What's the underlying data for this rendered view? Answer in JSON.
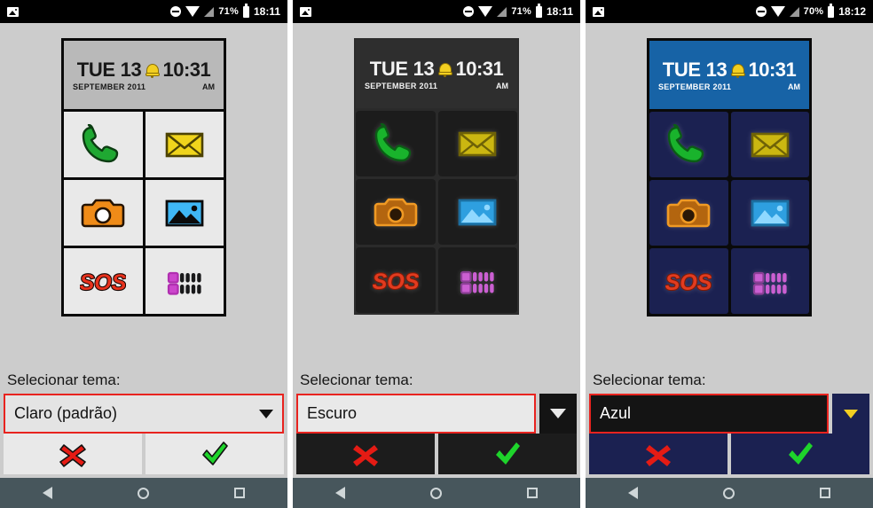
{
  "screens": [
    {
      "theme_key": "light",
      "statusbar": {
        "photo_icon": "photo-icon",
        "dnd_icon": "do-not-disturb-icon",
        "wifi_icon": "wifi-icon",
        "signal_icon": "signal-icon",
        "battery_percent": "71%",
        "battery_icon": "battery-icon",
        "time": "18:11"
      },
      "clock": {
        "date": "TUE 13",
        "time": "10:31",
        "month": "SEPTEMBER 2011",
        "ampm": "AM",
        "bell_icon": "alarm-bell-icon"
      },
      "tiles": [
        {
          "name": "phone",
          "icon": "phone-icon"
        },
        {
          "name": "messages",
          "icon": "envelope-icon"
        },
        {
          "name": "camera",
          "icon": "camera-icon"
        },
        {
          "name": "gallery",
          "icon": "picture-icon"
        },
        {
          "name": "sos",
          "icon": "sos-icon"
        },
        {
          "name": "apps",
          "icon": "apps-grid-icon"
        }
      ],
      "selector": {
        "label": "Selecionar tema:",
        "value": "Claro (padrão)",
        "caret_icon": "chevron-down-icon",
        "separate_arrow_button": false
      },
      "actions": {
        "cancel_icon": "red-x-icon",
        "confirm_icon": "green-check-icon"
      },
      "navbar": {
        "back_icon": "back-triangle-icon",
        "home_icon": "home-circle-icon",
        "recents_icon": "recents-square-icon"
      }
    },
    {
      "theme_key": "dark",
      "statusbar": {
        "photo_icon": "photo-icon",
        "dnd_icon": "do-not-disturb-icon",
        "wifi_icon": "wifi-icon",
        "signal_icon": "signal-icon",
        "battery_percent": "71%",
        "battery_icon": "battery-icon",
        "time": "18:11"
      },
      "clock": {
        "date": "TUE 13",
        "time": "10:31",
        "month": "SEPTEMBER 2011",
        "ampm": "AM",
        "bell_icon": "alarm-bell-icon"
      },
      "tiles": [
        {
          "name": "phone",
          "icon": "phone-icon"
        },
        {
          "name": "messages",
          "icon": "envelope-icon"
        },
        {
          "name": "camera",
          "icon": "camera-icon"
        },
        {
          "name": "gallery",
          "icon": "picture-icon"
        },
        {
          "name": "sos",
          "icon": "sos-icon"
        },
        {
          "name": "apps",
          "icon": "apps-grid-icon"
        }
      ],
      "selector": {
        "label": "Selecionar tema:",
        "value": "Escuro",
        "caret_icon": "chevron-down-icon",
        "separate_arrow_button": true
      },
      "actions": {
        "cancel_icon": "red-x-icon",
        "confirm_icon": "green-check-icon"
      },
      "navbar": {
        "back_icon": "back-triangle-icon",
        "home_icon": "home-circle-icon",
        "recents_icon": "recents-square-icon"
      }
    },
    {
      "theme_key": "blue",
      "statusbar": {
        "photo_icon": "photo-icon",
        "dnd_icon": "do-not-disturb-icon",
        "wifi_icon": "wifi-icon",
        "signal_icon": "signal-icon",
        "battery_percent": "70%",
        "battery_icon": "battery-icon",
        "time": "18:12"
      },
      "clock": {
        "date": "TUE 13",
        "time": "10:31",
        "month": "SEPTEMBER 2011",
        "ampm": "AM",
        "bell_icon": "alarm-bell-icon"
      },
      "tiles": [
        {
          "name": "phone",
          "icon": "phone-icon"
        },
        {
          "name": "messages",
          "icon": "envelope-icon"
        },
        {
          "name": "camera",
          "icon": "camera-icon"
        },
        {
          "name": "gallery",
          "icon": "picture-icon"
        },
        {
          "name": "sos",
          "icon": "sos-icon"
        },
        {
          "name": "apps",
          "icon": "apps-grid-icon"
        }
      ],
      "selector": {
        "label": "Selecionar tema:",
        "value": "Azul",
        "caret_icon": "chevron-down-icon",
        "separate_arrow_button": true
      },
      "actions": {
        "cancel_icon": "red-x-icon",
        "confirm_icon": "green-check-icon"
      },
      "navbar": {
        "back_icon": "back-triangle-icon",
        "home_icon": "home-circle-icon",
        "recents_icon": "recents-square-icon"
      }
    }
  ],
  "theme_options": [
    "Claro (padrão)",
    "Escuro",
    "Azul"
  ],
  "colors": {
    "page_background": "#cccccc",
    "statusbar": "#000000",
    "navbar": "#47565c",
    "highlight_border": "#e8231f",
    "light_tile": "#e9e9e9",
    "dark_tile": "#1c1c1c",
    "blue_tile": "#1b2151",
    "blue_clock": "#1763a6",
    "phone_green": "#16a32a",
    "envelope_yellow": "#e8d21a",
    "camera_orange": "#e8801a",
    "picture_blue": "#31b0ef",
    "sos_red": "#e82b1e",
    "apps_magenta": "#c martes"
  }
}
